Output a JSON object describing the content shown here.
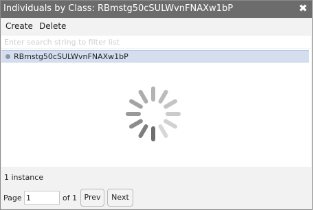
{
  "dialog": {
    "title": "Individuals by Class: RBmstg50cSULWvnFNAXw1bP",
    "close_glyph": "✖"
  },
  "menu": {
    "create_label": "Create",
    "delete_label": "Delete"
  },
  "filter": {
    "placeholder": "Enter search string to filter list",
    "value": ""
  },
  "list": {
    "items": [
      {
        "label": "RBmstg50cSULWvnFNAXw1bP",
        "selected": true
      }
    ],
    "loading": true
  },
  "status": {
    "count_text": "1 instance"
  },
  "pager": {
    "page_label": "Page",
    "page_value": "1",
    "of_text": "of 1",
    "prev_label": "Prev",
    "next_label": "Next"
  },
  "colors": {
    "titlebar": "#6c6c6c",
    "selected_row": "#d4deef",
    "spinner": "#8f8f8f"
  },
  "icons": [
    "close-icon",
    "bullet-icon",
    "loading-spinner-icon"
  ]
}
